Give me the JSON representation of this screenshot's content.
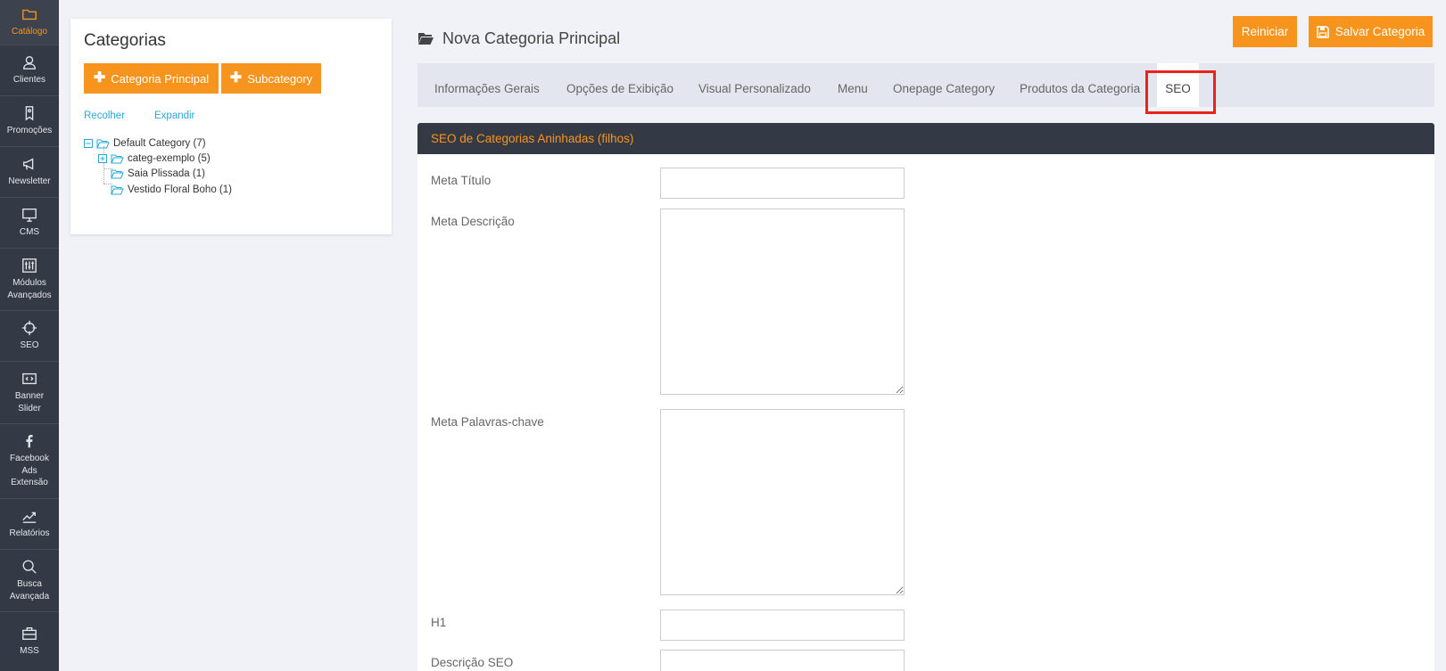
{
  "sidebar": {
    "items": [
      {
        "label": "Catálogo",
        "icon": "folder-icon",
        "active": true
      },
      {
        "label": "Clientes",
        "icon": "user-icon"
      },
      {
        "label": "Promoções",
        "icon": "tag-icon"
      },
      {
        "label": "Newsletter",
        "icon": "megaphone-icon"
      },
      {
        "label": "CMS",
        "icon": "monitor-icon"
      },
      {
        "label": "Módulos\nAvançados",
        "icon": "sliders-icon"
      },
      {
        "label": "SEO",
        "icon": "crosshair-icon"
      },
      {
        "label": "Banner\nSlider",
        "icon": "code-icon"
      },
      {
        "label": "Facebook\nAds\nExtensão",
        "icon": "facebook-icon"
      },
      {
        "label": "Relatórios",
        "icon": "chart-line-icon"
      },
      {
        "label": "Busca\nAvançada",
        "icon": "search-icon"
      },
      {
        "label": "MSS",
        "icon": "briefcase-icon"
      }
    ]
  },
  "categories": {
    "title": "Categorias",
    "add_main_label": "Categoria Principal",
    "add_sub_label": "Subcategory",
    "collapse_label": "Recolher",
    "expand_label": "Expandir",
    "tree": [
      {
        "label": "Default Category (7)"
      },
      {
        "label": "categ-exemplo (5)"
      },
      {
        "label": "Saia Plissada (1)"
      },
      {
        "label": "Vestido Floral Boho (1)"
      }
    ]
  },
  "header": {
    "page_title": "Nova Categoria Principal",
    "reset_label": "Reiniciar",
    "save_label": "Salvar Categoria"
  },
  "tabs": [
    {
      "label": "Informações Gerais"
    },
    {
      "label": "Opções de Exibição"
    },
    {
      "label": "Visual Personalizado"
    },
    {
      "label": "Menu"
    },
    {
      "label": "Onepage Category"
    },
    {
      "label": "Produtos da Categoria"
    },
    {
      "label": "SEO",
      "active": true
    }
  ],
  "seo_section": {
    "title": "SEO de Categorias Aninhadas (filhos)",
    "fields": {
      "meta_title": {
        "label": "Meta Título",
        "value": ""
      },
      "meta_description": {
        "label": "Meta Descrição",
        "value": ""
      },
      "meta_keywords": {
        "label": "Meta Palavras-chave",
        "value": ""
      },
      "h1": {
        "label": "H1",
        "value": ""
      },
      "seo_description": {
        "label": "Descrição SEO",
        "value": ""
      }
    }
  },
  "colors": {
    "accent": "#f7941d",
    "sidebar_bg": "#343a45",
    "highlight": "#e8231a",
    "link": "#2aa7d9"
  }
}
